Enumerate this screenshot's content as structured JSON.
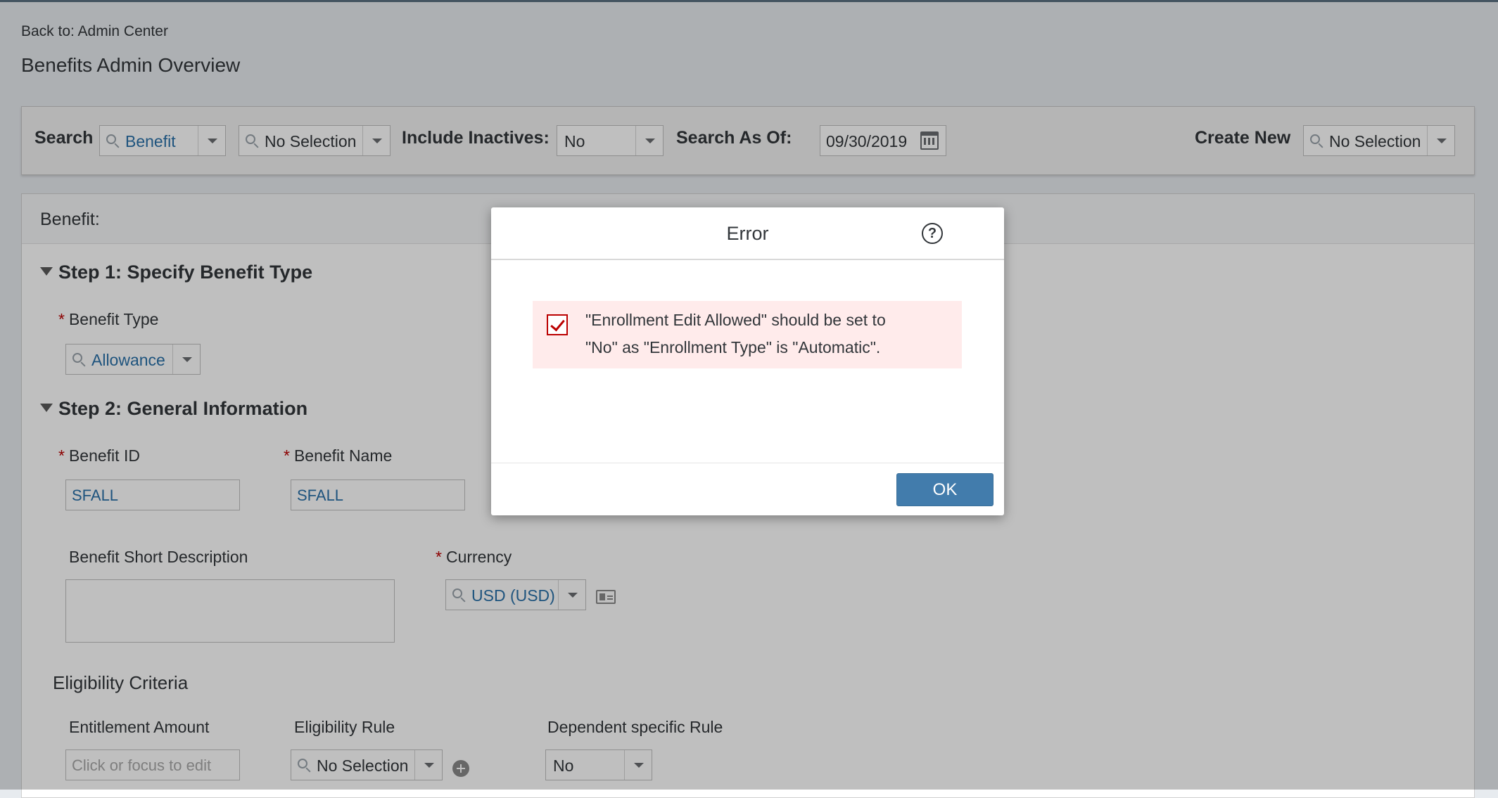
{
  "header": {
    "back_link": "Back to: Admin Center",
    "page_title": "Benefits Admin Overview"
  },
  "search_bar": {
    "search_label": "Search",
    "search_type": "Benefit",
    "search_object": "No Selection",
    "include_inactives_label": "Include Inactives:",
    "include_inactives_value": "No",
    "search_as_of_label": "Search As Of:",
    "search_as_of_value": "09/30/2019",
    "create_new_label": "Create New",
    "create_new_value": "No Selection"
  },
  "benefit_panel": {
    "header": "Benefit:",
    "step1": {
      "title": "Step 1: Specify Benefit Type",
      "benefit_type_label": "Benefit Type",
      "benefit_type_value": "Allowance"
    },
    "step2": {
      "title": "Step 2: General Information",
      "benefit_id_label": "Benefit ID",
      "benefit_id_value": "SFALL",
      "benefit_name_label": "Benefit Name",
      "benefit_name_value": "SFALL",
      "short_desc_label": "Benefit Short Description",
      "short_desc_value": "",
      "currency_label": "Currency",
      "currency_value": "USD (USD)"
    },
    "eligibility": {
      "title": "Eligibility Criteria",
      "entitlement_label": "Entitlement Amount",
      "entitlement_placeholder": "Click or focus to edit",
      "rule_label": "Eligibility Rule",
      "rule_value": "No Selection",
      "dependent_label": "Dependent specific Rule",
      "dependent_value": "No"
    },
    "required_marker": "*"
  },
  "dialog": {
    "title": "Error",
    "message_line1": "\"Enrollment Edit Allowed\" should be set to",
    "message_line2": "\"No\" as \"Enrollment Type\" is \"Automatic\".",
    "ok_label": "OK",
    "help_glyph": "?"
  },
  "colors": {
    "brand_blue": "#427cac",
    "link_blue": "#2a71a8",
    "error_red": "#bb0000",
    "error_bg": "#ffebeb"
  }
}
